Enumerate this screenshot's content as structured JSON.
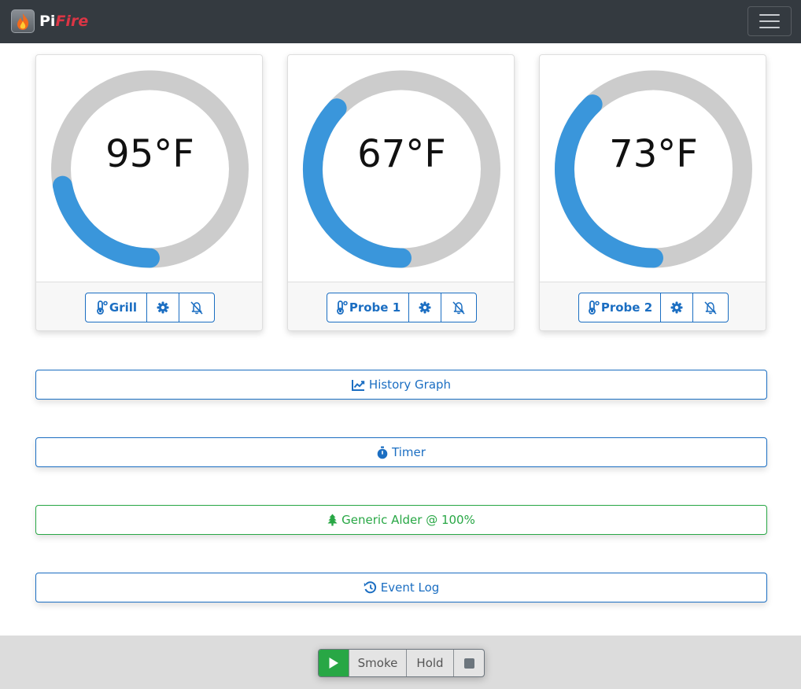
{
  "app": {
    "brand_pi": "Pi",
    "brand_fire": "Fire",
    "logo_icon": "flame-icon",
    "menu_icon": "hamburger-icon"
  },
  "colors": {
    "accent": "#1b6ec2",
    "gauge_fill": "#3a96db",
    "gauge_track": "#cccccc",
    "success": "#28a745",
    "navbar": "#343a40"
  },
  "gauges": [
    {
      "reading": "95°F",
      "level": 0.22,
      "label": "Grill",
      "icons": [
        "thermometer-icon",
        "gear-icon",
        "bell-slash-icon"
      ]
    },
    {
      "reading": "67°F",
      "level": 0.37,
      "label": "Probe 1",
      "icons": [
        "thermometer-icon",
        "gear-icon",
        "bell-slash-icon"
      ]
    },
    {
      "reading": "73°F",
      "level": 0.38,
      "label": "Probe 2",
      "icons": [
        "thermometer-icon",
        "gear-icon",
        "bell-slash-icon"
      ]
    }
  ],
  "actions": {
    "history": "History Graph",
    "timer": "Timer",
    "pellets": "Generic Alder @ 100%",
    "eventlog": "Event Log"
  },
  "control": {
    "smoke": "Smoke",
    "hold": "Hold"
  }
}
